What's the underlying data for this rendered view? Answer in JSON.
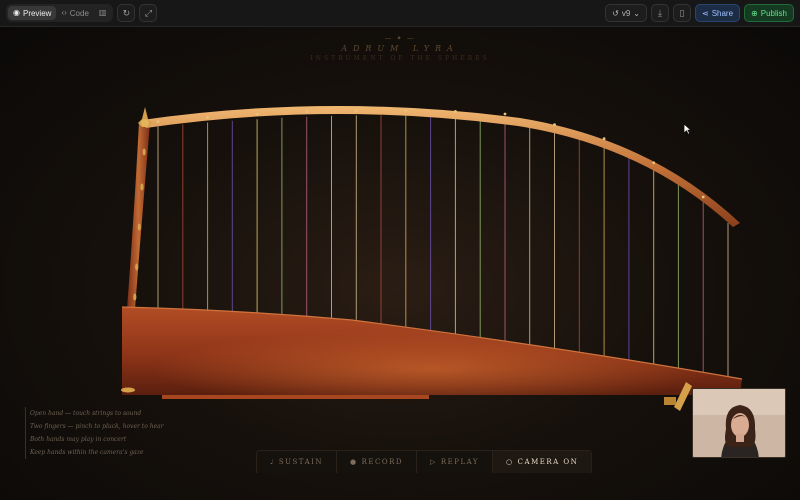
{
  "toolbar": {
    "view_tabs": [
      {
        "label": "Preview",
        "icon": "eye-icon",
        "active": true
      },
      {
        "label": "Code",
        "icon": "code-icon",
        "active": false
      }
    ],
    "version_label": "v9",
    "share_label": "Share",
    "publish_label": "Publish"
  },
  "instrument": {
    "ornament": "— ✦ —",
    "name": "ADRUM LYRA",
    "subtitle": "INSTRUMENT OF THE SPHERES",
    "string_count": 24
  },
  "help_lines": [
    "Open hand — touch strings to sound",
    "Two fingers — pinch to pluck, hover to hear",
    "Both hands may play in concert",
    "Keep hands within the camera's gaze"
  ],
  "controls": [
    {
      "label": "SUSTAIN",
      "glyph": "♩",
      "active": false
    },
    {
      "label": "RECORD",
      "glyph": "●",
      "active": false
    },
    {
      "label": "REPLAY",
      "glyph": "▷",
      "active": false
    },
    {
      "label": "CAMERA ON",
      "glyph": "○",
      "active": true
    }
  ],
  "colors": {
    "wood": "#9c3c1c",
    "gold": "#d4a14a",
    "background": "#17110c",
    "publish_accent": "#62e08c",
    "share_accent": "#9fc1ff"
  }
}
